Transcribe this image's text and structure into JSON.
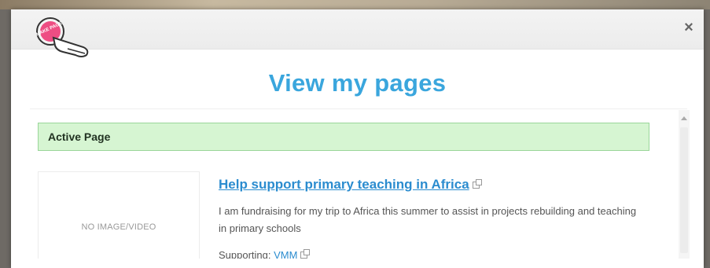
{
  "modal": {
    "title": "View my pages",
    "close_label": "×",
    "logo_text": "MAKE PAGE"
  },
  "section": {
    "active_label": "Active Page"
  },
  "pages": [
    {
      "thumbnail_text": "NO IMAGE/VIDEO",
      "title": "Help support primary teaching in Africa",
      "description": "I am fundraising for my trip to Africa this summer to assist in projects rebuilding and teaching in primary schools",
      "supporting_label": "Supporting:",
      "supporting_link": "VMM"
    }
  ],
  "colors": {
    "title": "#3aa6dd",
    "link": "#2b8ccf",
    "active_bg": "#d6f5d2",
    "active_border": "#9ad69a"
  },
  "icons": {
    "logo": "hand-pointer-logo",
    "close": "close-icon",
    "external": "external-link-icon"
  }
}
